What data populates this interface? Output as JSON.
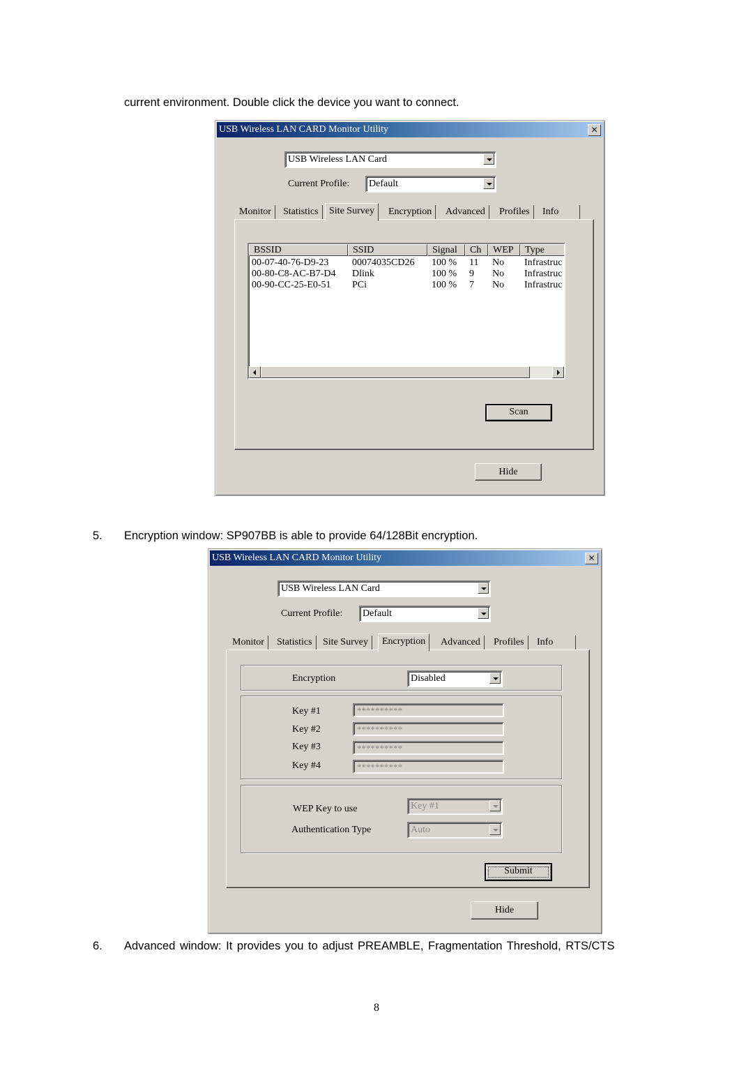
{
  "doc": {
    "intro_line": "current environment. Double click the device you want to connect.",
    "step5_num": "5.",
    "step5_text": "Encryption window: SP907BB is able to provide 64/128Bit encryption.",
    "step6_num": "6.",
    "step6_text": "Advanced window: It provides you to adjust PREAMBLE, Fragmentation Threshold, RTS/CTS",
    "page_number": "8"
  },
  "window1": {
    "title": "USB Wireless LAN CARD Monitor Utility",
    "close_icon": "close-icon",
    "device_combo": "USB Wireless LAN Card",
    "profile_label": "Current Profile:",
    "profile_combo": "Default",
    "tabs": [
      {
        "label": "Monitor"
      },
      {
        "label": "Statistics"
      },
      {
        "label": "Site Survey",
        "active": true
      },
      {
        "label": "Encryption"
      },
      {
        "label": "Advanced"
      },
      {
        "label": "Profiles"
      },
      {
        "label": "Info"
      }
    ],
    "site_survey": {
      "columns": [
        "BSSID",
        "SSID",
        "Signal",
        "Ch",
        "WEP",
        "Type"
      ],
      "rows": [
        [
          "00-07-40-76-D9-23",
          "00074035CD26",
          "100 %",
          "11",
          "No",
          "Infrastruc"
        ],
        [
          "00-80-C8-AC-B7-D4",
          "Dlink",
          "100 %",
          "9",
          "No",
          "Infrastruc"
        ],
        [
          "00-90-CC-25-E0-51",
          "PCi",
          "100 %",
          "7",
          "No",
          "Infrastruc"
        ]
      ]
    },
    "scan_button": "Scan",
    "hide_button": "Hide"
  },
  "window2": {
    "title": "USB Wireless LAN CARD Monitor Utility",
    "device_combo": "USB Wireless LAN Card",
    "profile_label": "Current Profile:",
    "profile_combo": "Default",
    "tabs": [
      {
        "label": "Monitor"
      },
      {
        "label": "Statistics"
      },
      {
        "label": "Site Survey"
      },
      {
        "label": "Encryption",
        "active": true
      },
      {
        "label": "Advanced"
      },
      {
        "label": "Profiles"
      },
      {
        "label": "Info"
      }
    ],
    "encryption_label": "Encryption",
    "encryption_value": "Disabled",
    "keys": [
      {
        "label": "Key #1",
        "value": "**********"
      },
      {
        "label": "Key #2",
        "value": "**********"
      },
      {
        "label": "Key #3",
        "value": "**********"
      },
      {
        "label": "Key #4",
        "value": "**********"
      }
    ],
    "wep_key_label": "WEP Key to use",
    "wep_key_value": "Key #1",
    "auth_label": "Authentication Type",
    "auth_value": "Auto",
    "submit_button": "Submit",
    "hide_button": "Hide"
  }
}
